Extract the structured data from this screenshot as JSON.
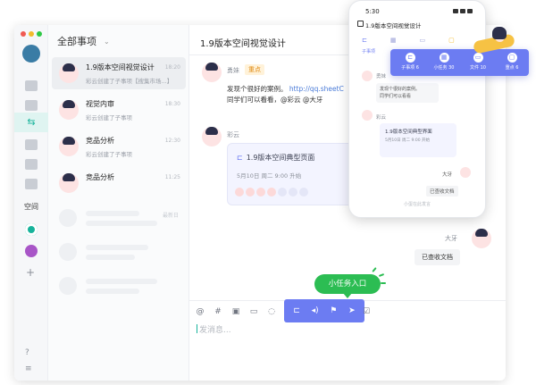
{
  "sidebar": {
    "space_label": "空间"
  },
  "list": {
    "header": "全部事项",
    "items": [
      {
        "title": "1.9版本空间视觉设计",
        "sub": "彩云创建了子事项【搜集市场...】",
        "time": "18:20"
      },
      {
        "title": "视觉内审",
        "sub": "彩云创建了子事项",
        "time": "18:30"
      },
      {
        "title": "竞品分析",
        "sub": "彩云创建了子事项",
        "time": "12:30"
      },
      {
        "title": "竞品分析",
        "sub": "",
        "time": "11:25"
      }
    ],
    "skeleton_time": "最新日"
  },
  "chat": {
    "title": "1.9版本空间视觉设计",
    "msg1": {
      "sender": "勇妹",
      "tag": "重点",
      "line1": "发现个很好的案例。",
      "link": "http://qq.sheetC",
      "line2": "同学们可以看看，@彩云 @大牙"
    },
    "msg2": {
      "sender": "彩云",
      "card_title": "1.9版本空间典型页面",
      "card_date": "5月10日 周二 9:00 升始"
    },
    "msg3": {
      "sender": "大牙",
      "text": "已查收文档"
    },
    "input_placeholder": "发消息..."
  },
  "tooltip": "小任务入口",
  "phone": {
    "time": "5:30",
    "title": "1.9版本空间视觉设计",
    "tab_label": "子事项",
    "msg1_name": "勇妹",
    "msg1_text_a": "发现个很好的案例。",
    "msg1_text_b": "同学们可以看看",
    "msg2_name": "彩云",
    "card_title": "1.9版本空间典型界面",
    "card_date": "5月10日 周二 9:00 开始",
    "right_name": "大牙",
    "right_text": "已查收文档",
    "input_hint": "小蛋在此发言"
  },
  "panel": {
    "items": [
      {
        "label": "子事项 6",
        "icon": "branch-icon"
      },
      {
        "label": "小任务 30",
        "icon": "task-icon"
      },
      {
        "label": "文件 10",
        "icon": "file-icon"
      },
      {
        "label": "重点 6",
        "icon": "star-icon"
      }
    ]
  },
  "colors": {
    "accent_purple": "#6c7cf2",
    "accent_green": "#2cbd53",
    "teal": "#17b39b"
  }
}
